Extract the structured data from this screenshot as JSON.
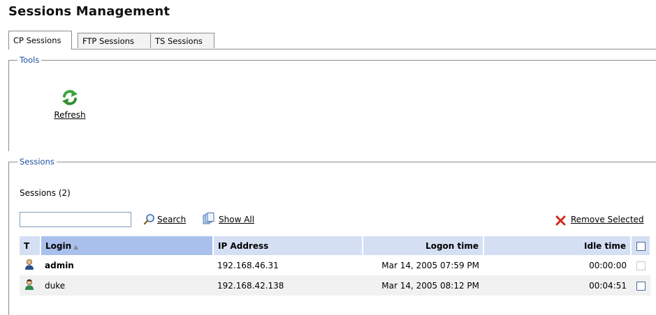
{
  "page": {
    "title": "Sessions Management"
  },
  "tabs": [
    {
      "label": "CP Sessions",
      "active": true
    },
    {
      "label": "FTP Sessions",
      "active": false
    },
    {
      "label": "TS Sessions",
      "active": false
    }
  ],
  "tools": {
    "legend": "Tools",
    "refresh_label": "Refresh",
    "refresh_icon": "refresh-icon"
  },
  "sessions": {
    "legend": "Sessions",
    "count_text": "Sessions (2)",
    "search": {
      "value": "",
      "placeholder": ""
    },
    "search_label": "Search",
    "show_all_label": "Show All",
    "remove_selected_label": "Remove Selected",
    "columns": [
      "T",
      "Login",
      "IP Address",
      "Logon time",
      "Idle time"
    ],
    "sort_column": "Login",
    "sort_direction": "ascending",
    "rows": [
      {
        "type_icon": "user-icon",
        "login": "admin",
        "ip": "192.168.46.31",
        "logon_time": "Mar 14, 2005 07:59 PM",
        "idle_time": "00:00:00",
        "selectable": false,
        "bold": true
      },
      {
        "type_icon": "user-icon",
        "login": "duke",
        "ip": "192.168.42.138",
        "logon_time": "Mar 14, 2005 08:12 PM",
        "idle_time": "00:04:51",
        "selectable": true,
        "bold": false
      }
    ]
  },
  "colors": {
    "legend_text": "#1a4fa0",
    "header_bg": "#d5dff4",
    "sorted_header_bg": "#a9c0ec",
    "refresh_green": "#3aa43a",
    "remove_red": "#d42a1a"
  }
}
